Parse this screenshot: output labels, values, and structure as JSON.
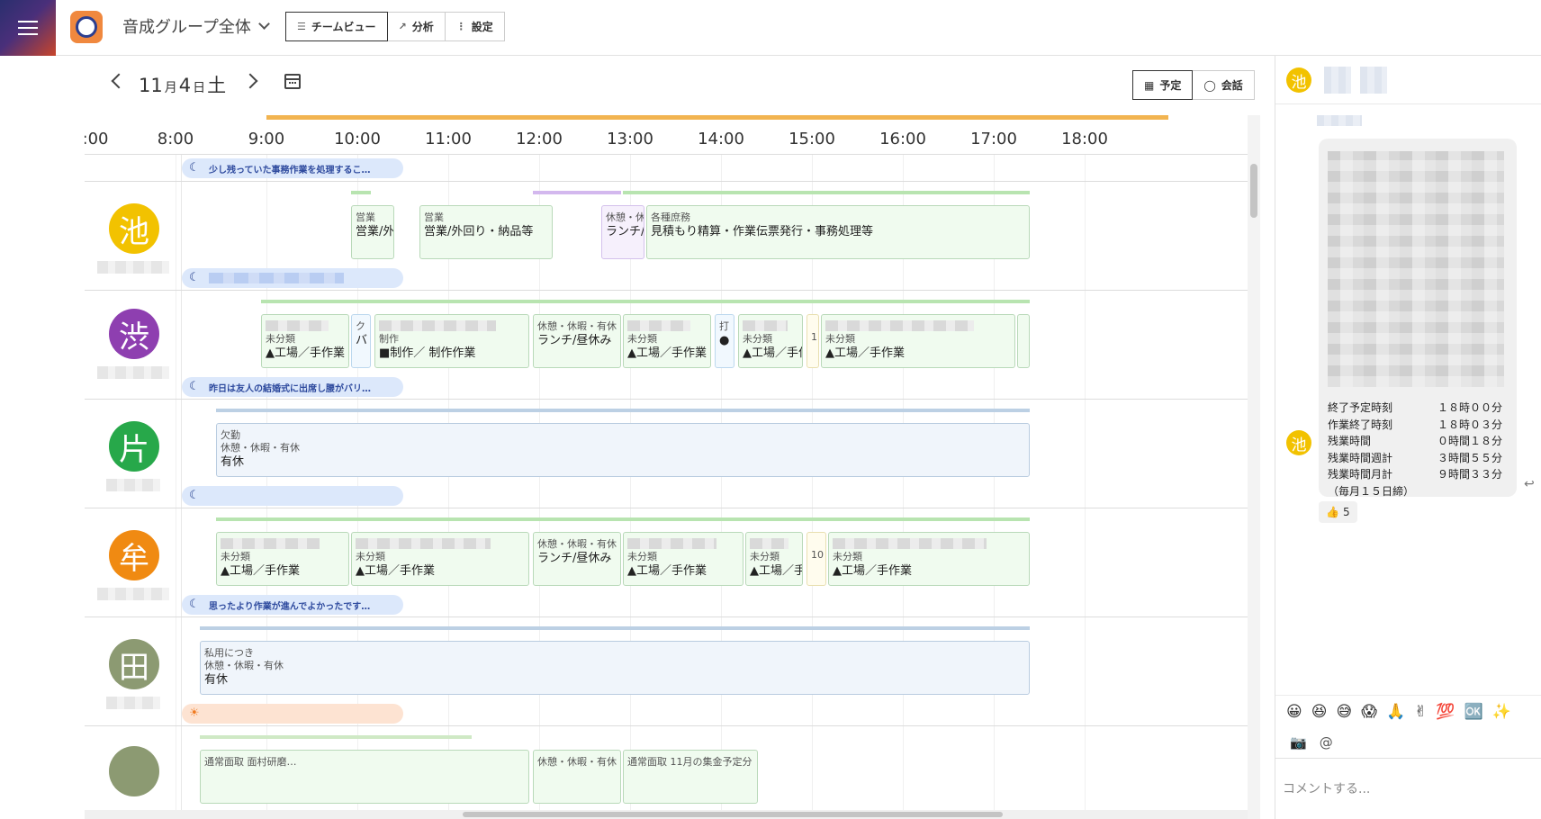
{
  "header": {
    "group_name": "音成グループ全体",
    "views": [
      {
        "icon": "☰",
        "label": "チームビュー"
      },
      {
        "icon": "↗",
        "label": "分析"
      },
      {
        "icon": "⋮",
        "label": "設定"
      }
    ]
  },
  "datebar": {
    "month": "11",
    "month_unit": "月",
    "day": "4",
    "day_unit": "日",
    "weekday": "土",
    "modes": [
      {
        "label": "予定"
      },
      {
        "label": "会話"
      }
    ]
  },
  "timeline": {
    "hours": [
      ":00",
      "8:00",
      "9:00",
      "10:00",
      "11:00",
      "12:00",
      "13:00",
      "14:00",
      "15:00",
      "16:00",
      "17:00",
      "18:00"
    ],
    "top_bubble": "少し残っていた事務作業を処理するこ…",
    "rows": [
      {
        "avatar_char": "池",
        "avatar_color": "#f2c200",
        "bubble": "",
        "blocks": [
          {
            "small": "営業",
            "big": "営業/外"
          },
          {
            "small": "営業",
            "big": "営業/外回り・納品等"
          },
          {
            "small": "休憩・休",
            "big": "ランチ/"
          },
          {
            "small": "各種庶務",
            "big": "見積もり精算・作業伝票発行・事務処理等"
          }
        ]
      },
      {
        "avatar_char": "渋",
        "avatar_color": "#8e3fb0",
        "bubble": "昨日は友人の結婚式に出席し腰がバリ…",
        "blocks": [
          {
            "small": "未分類",
            "big": "▲工場／手作業"
          },
          {
            "small": "ク",
            "big": "バ"
          },
          {
            "small": "制作",
            "big": "■制作／ 制作作業"
          },
          {
            "small": "休憩・休暇・有休",
            "big": "ランチ/昼休み"
          },
          {
            "small": "未分類",
            "big": "▲工場／手作業"
          },
          {
            "small": "打",
            "big": "●"
          },
          {
            "small": "未分類",
            "big": "▲工場／手作"
          },
          {
            "small": "1",
            "big": ""
          },
          {
            "small": "未分類",
            "big": "▲工場／手作業"
          }
        ]
      },
      {
        "avatar_char": "片",
        "avatar_color": "#27a84a",
        "bubble": "",
        "blocks": [
          {
            "small": "欠勤",
            "small2": "休憩・休暇・有休",
            "big": "有休"
          }
        ]
      },
      {
        "avatar_char": "牟",
        "avatar_color": "#f08a12",
        "bubble": "思ったより作業が進んでよかったです…",
        "blocks": [
          {
            "small": "未分類",
            "big": "▲工場／手作業"
          },
          {
            "small": "未分類",
            "big": "▲工場／手作業"
          },
          {
            "small": "休憩・休暇・有休",
            "big": "ランチ/昼休み"
          },
          {
            "small": "未分類",
            "big": "▲工場／手作業"
          },
          {
            "small": "未分類",
            "big": "▲工場／手"
          },
          {
            "small": "10",
            "big": ""
          },
          {
            "small": "未分類",
            "big": "▲工場／手作業"
          }
        ]
      },
      {
        "avatar_char": "田",
        "avatar_color": "#8c9a72",
        "bubble": "",
        "blocks": [
          {
            "small": "私用につき",
            "small2": "休憩・休暇・有休",
            "big": "有休"
          }
        ]
      }
    ],
    "last_row_blocks": [
      "通常面取 面村研磨…",
      "休憩・休暇・有休",
      "通常面取 11月の集金予定分"
    ]
  },
  "chat": {
    "avatar_char": "池",
    "summary": [
      {
        "k": "終了予定時刻",
        "v": "１８時００分"
      },
      {
        "k": "作業終了時刻",
        "v": "１８時０３分"
      },
      {
        "k": "残業時間",
        "v": "０時間１８分"
      },
      {
        "k": "残業時間週計",
        "v": "３時間５５分"
      },
      {
        "k": "残業時間月計",
        "v": "９時間３３分"
      }
    ],
    "note": "（毎月１５日締）",
    "reaction": {
      "emoji": "👍",
      "count": "5"
    },
    "emojis": [
      "😀",
      "😆",
      "😅",
      "😱",
      "🙏",
      "✌",
      "💯",
      "🆗",
      "✨"
    ],
    "tools": [
      "📷",
      "@"
    ],
    "comment_placeholder": "コメントする..."
  }
}
